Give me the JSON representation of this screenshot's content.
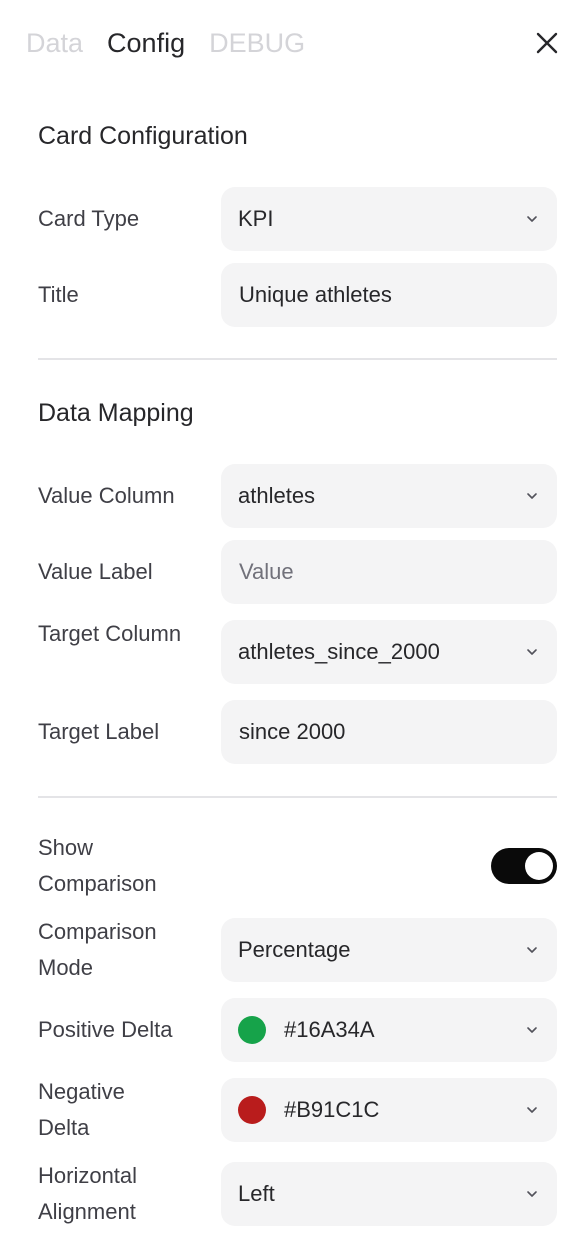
{
  "tabs": [
    {
      "label": "Data",
      "active": false
    },
    {
      "label": "Config",
      "active": true
    },
    {
      "label": "DEBUG",
      "active": false
    }
  ],
  "icons": {
    "close": "close-icon",
    "chevron": "chevron-down-icon"
  },
  "card_configuration": {
    "title": "Card Configuration",
    "card_type": {
      "label": "Card Type",
      "value": "KPI"
    },
    "title_field": {
      "label": "Title",
      "value": "Unique athletes"
    }
  },
  "data_mapping": {
    "title": "Data Mapping",
    "value_column": {
      "label": "Value Column",
      "value": "athletes"
    },
    "value_label": {
      "label": "Value Label",
      "value": "",
      "placeholder": "Value"
    },
    "target_column": {
      "label": "Target Column",
      "value": "athletes_since_2000"
    },
    "target_label": {
      "label": "Target Label",
      "value": "since 2000"
    }
  },
  "comparison": {
    "show_comparison": {
      "label": "Show Comparison",
      "enabled": true
    },
    "comparison_mode": {
      "label": "Comparison Mode",
      "value": "Percentage"
    },
    "positive_delta": {
      "label": "Positive Delta",
      "value": "#16A34A",
      "color": "#16A34A"
    },
    "negative_delta": {
      "label": "Negative Delta",
      "value": "#B91C1C",
      "color": "#B91C1C"
    },
    "horizontal_alignment": {
      "label": "Horizontal Alignment",
      "value": "Left"
    }
  }
}
